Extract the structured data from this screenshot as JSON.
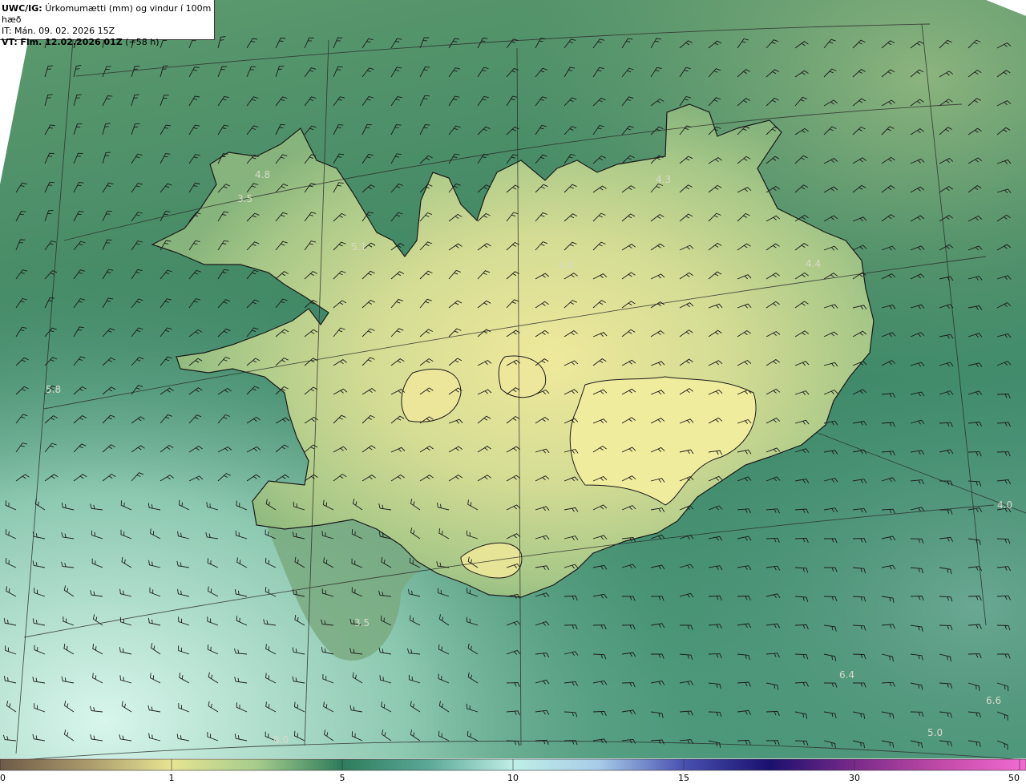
{
  "header": {
    "model_label": "UWC/IG:",
    "title": "Úrkomumætti (mm) og vindur í 100m hæð",
    "it_label": "IT:",
    "it_value": "Mán. 09. 02. 2026 15Z",
    "vt_label": "VT:",
    "vt_value": "Fim. 12.02.2026 01Z",
    "vt_offset": "(+58 h)"
  },
  "map_values": [
    {
      "text": "4.8"
    },
    {
      "text": "3.5"
    },
    {
      "text": "5.1"
    },
    {
      "text": "4.3"
    },
    {
      "text": "4.8"
    },
    {
      "text": "4.4"
    },
    {
      "text": "5.8"
    },
    {
      "text": "4.0"
    },
    {
      "text": "3.5"
    },
    {
      "text": "6.4"
    },
    {
      "text": "6.6"
    },
    {
      "text": "5.0"
    },
    {
      "text": "8.0"
    }
  ],
  "colorbar": {
    "ticks": [
      {
        "label": "0",
        "value": 0
      },
      {
        "label": "1",
        "value": 1
      },
      {
        "label": "5",
        "value": 5
      },
      {
        "label": "10",
        "value": 10
      },
      {
        "label": "15",
        "value": 15
      },
      {
        "label": "30",
        "value": 30
      },
      {
        "label": "50",
        "value": 50
      }
    ],
    "colors": [
      "#6e5a48",
      "#a8986a",
      "#e6e492",
      "#a6cc8c",
      "#2e7c5c",
      "#5aa896",
      "#bfeee6",
      "#a8cce8",
      "#4850b0",
      "#1a106e",
      "#7a2a8a",
      "#c24aa8",
      "#f26cd2"
    ]
  },
  "colors": {
    "land_high": "#eae79a",
    "land_mid": "#b8d08c",
    "sea_green": "#4d8e68",
    "sea_dark": "#2f7a5c",
    "sea_light": "#bfe8d4"
  }
}
